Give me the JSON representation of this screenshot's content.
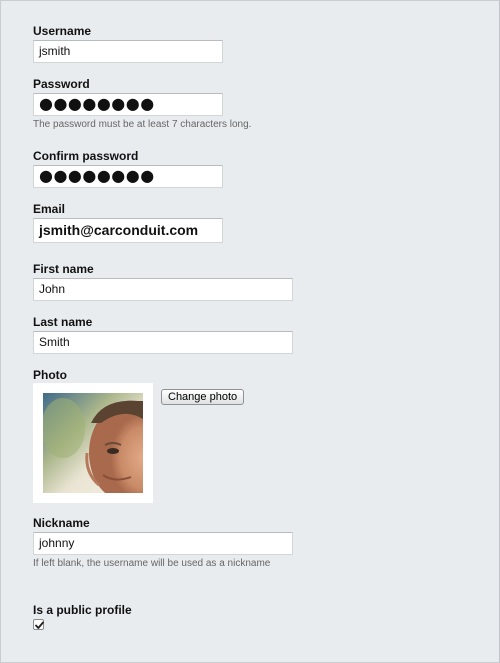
{
  "form": {
    "username": {
      "label": "Username",
      "value": "jsmith"
    },
    "password": {
      "label": "Password",
      "value": "●●●●●●●●",
      "hint": "The password must be at least 7 characters long."
    },
    "confirm_password": {
      "label": "Confirm password",
      "value": "●●●●●●●●"
    },
    "email": {
      "label": "Email",
      "value": "jsmith@carconduit.com"
    },
    "first_name": {
      "label": "First name",
      "value": "John"
    },
    "last_name": {
      "label": "Last name",
      "value": "Smith"
    },
    "photo": {
      "label": "Photo",
      "change_label": "Change photo"
    },
    "nickname": {
      "label": "Nickname",
      "value": "johnny",
      "hint": "If left blank, the username will be used as a nickname"
    },
    "public_profile": {
      "label": "Is a public profile",
      "checked": true
    }
  },
  "colors": {
    "background": "#e9ecef",
    "field_border": "#d3d6d9",
    "hint_text": "#666666"
  }
}
